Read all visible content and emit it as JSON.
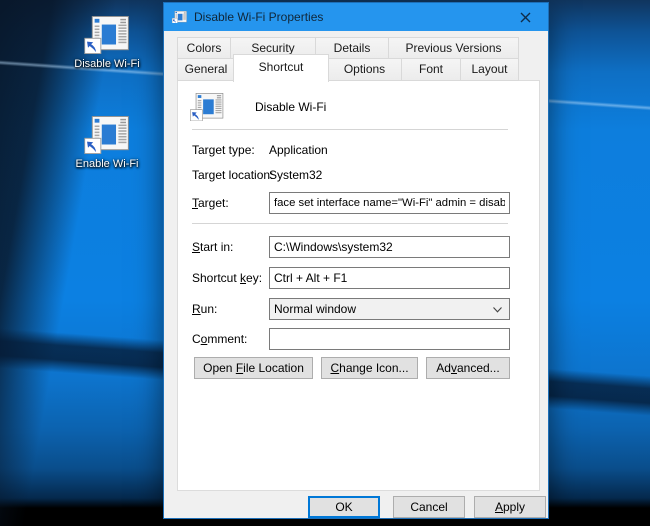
{
  "colors": {
    "titlebar": "#2595EE",
    "focus_accent": "#0078D7",
    "desktop_blue": "#0C80E2"
  },
  "desktop": {
    "icons": [
      {
        "label": "Disable Wi-Fi"
      },
      {
        "label": "Enable Wi-Fi"
      }
    ]
  },
  "dialog": {
    "title": "Disable Wi-Fi Properties",
    "tabs_row1": [
      "Colors",
      "Security",
      "Details",
      "Previous Versions"
    ],
    "tabs_row2": [
      "General",
      "Shortcut",
      "Options",
      "Font",
      "Layout"
    ],
    "active_tab": "Shortcut",
    "header": {
      "shortcut_name": "Disable Wi-Fi"
    },
    "fields": {
      "target_type": {
        "label": "Target type:",
        "value": "Application"
      },
      "target_location": {
        "label": "Target location:",
        "value": "System32"
      },
      "target": {
        "pre": "",
        "accel": "T",
        "rest": "arget:",
        "value": "face set interface name=\"Wi-Fi\" admin = disabled"
      },
      "start_in": {
        "pre": "",
        "accel": "S",
        "rest": "tart in:",
        "value": "C:\\Windows\\system32"
      },
      "shortcut_key": {
        "pre": "Shortcut ",
        "accel": "k",
        "rest": "ey:",
        "value": "Ctrl + Alt + F1"
      },
      "run": {
        "pre": "",
        "accel": "R",
        "rest": "un:",
        "value": "Normal window"
      },
      "comment": {
        "pre": "C",
        "accel": "o",
        "rest": "mment:",
        "value": ""
      }
    },
    "action_buttons": {
      "open_file_location": {
        "pre": "Open ",
        "accel": "F",
        "rest": "ile Location"
      },
      "change_icon": {
        "pre": "",
        "accel": "C",
        "rest": "hange Icon..."
      },
      "advanced": {
        "pre": "Ad",
        "accel": "v",
        "rest": "anced..."
      }
    },
    "footer": {
      "ok": "OK",
      "cancel": "Cancel",
      "apply": {
        "pre": "",
        "accel": "A",
        "rest": "pply"
      }
    }
  }
}
